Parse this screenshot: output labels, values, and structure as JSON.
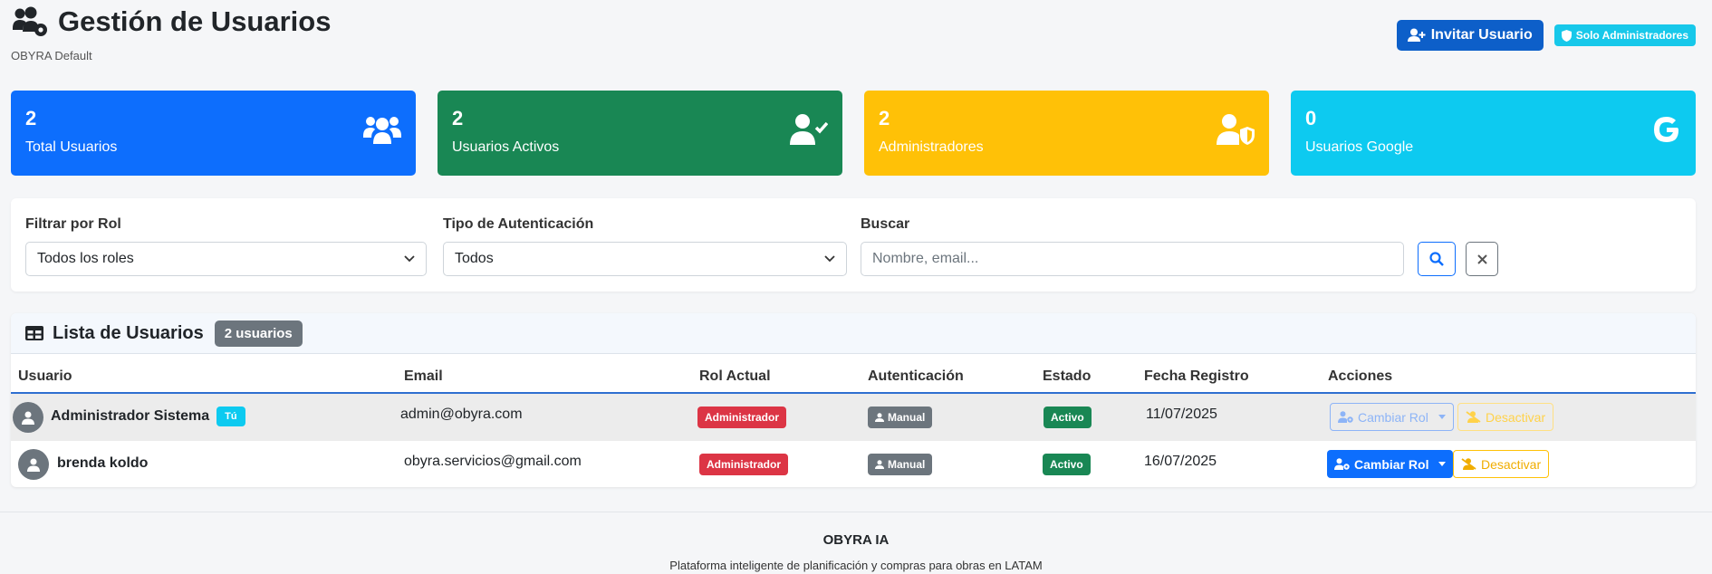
{
  "header": {
    "title": "Gestión de Usuarios",
    "subtitle": "OBYRA Default",
    "invite_label": "Invitar Usuario",
    "admin_only_label": "Solo Administradores"
  },
  "stats": [
    {
      "value": "2",
      "label": "Total Usuarios",
      "color": "#0d6efd",
      "icon": "users-icon"
    },
    {
      "value": "2",
      "label": "Usuarios Activos",
      "color": "#198754",
      "icon": "user-check-icon"
    },
    {
      "value": "2",
      "label": "Administradores",
      "color": "#ffc107",
      "icon": "user-shield-icon"
    },
    {
      "value": "0",
      "label": "Usuarios Google",
      "color": "#0dcaf0",
      "icon": "google-icon"
    }
  ],
  "filters": {
    "role_label": "Filtrar por Rol",
    "role_value": "Todos los roles",
    "auth_label": "Tipo de Autenticación",
    "auth_value": "Todos",
    "search_label": "Buscar",
    "search_placeholder": "Nombre, email..."
  },
  "table": {
    "title": "Lista de Usuarios",
    "count_badge": "2 usuarios",
    "columns": [
      "Usuario",
      "Email",
      "Rol Actual",
      "Autenticación",
      "Estado",
      "Fecha Registro",
      "Acciones"
    ],
    "rows": [
      {
        "name": "Administrador Sistema",
        "you_badge": "Tú",
        "email": "admin@obyra.com",
        "role": "Administrador",
        "auth": "Manual",
        "status": "Activo",
        "date": "11/07/2025",
        "change_role": "Cambiar Rol",
        "deactivate": "Desactivar"
      },
      {
        "name": "brenda koldo",
        "email": "obyra.servicios@gmail.com",
        "role": "Administrador",
        "auth": "Manual",
        "status": "Activo",
        "date": "16/07/2025",
        "change_role": "Cambiar Rol",
        "deactivate": "Desactivar"
      }
    ]
  },
  "footer": {
    "brand": "OBYRA IA",
    "tagline": "Plataforma inteligente de planificación y compras para obras en LATAM"
  }
}
